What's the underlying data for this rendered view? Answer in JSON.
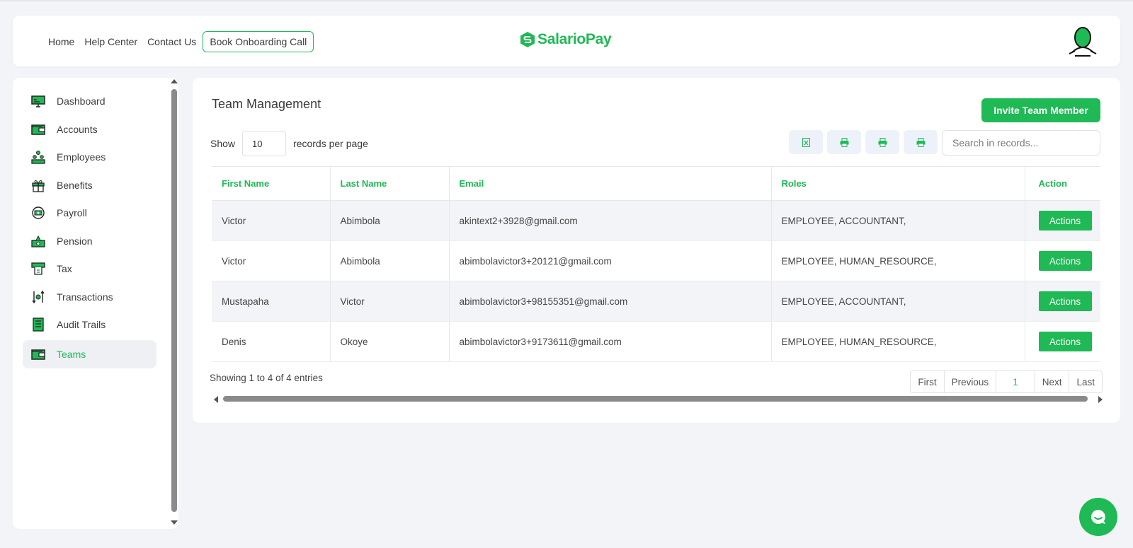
{
  "header": {
    "nav": [
      "Home",
      "Help Center",
      "Contact Us"
    ],
    "onboarding_button": "Book Onboarding Call",
    "brand": "SalarioPay"
  },
  "colors": {
    "accent": "#1fb955",
    "background": "#f3f4f7"
  },
  "sidebar": {
    "items": [
      {
        "label": "Dashboard",
        "icon": "monitor-icon"
      },
      {
        "label": "Accounts",
        "icon": "wallet-icon"
      },
      {
        "label": "Employees",
        "icon": "people-icon"
      },
      {
        "label": "Benefits",
        "icon": "gift-icon"
      },
      {
        "label": "Payroll",
        "icon": "cash-cycle-icon"
      },
      {
        "label": "Pension",
        "icon": "money-bag-icon"
      },
      {
        "label": "Tax",
        "icon": "receipt-icon"
      },
      {
        "label": "Transactions",
        "icon": "transfer-icon"
      },
      {
        "label": "Audit Trails",
        "icon": "clipboard-icon"
      },
      {
        "label": "Teams",
        "icon": "team-wallet-icon",
        "active": true
      }
    ]
  },
  "main": {
    "title": "Team Management",
    "invite_button": "Invite Team Member",
    "show_label": "Show",
    "per_page": "10",
    "records_label": "records per page",
    "search_placeholder": "Search in records...",
    "toolbar": [
      "excel-export-icon",
      "print-icon",
      "print-icon",
      "print-icon"
    ],
    "columns": [
      "First Name",
      "Last Name",
      "Email",
      "Roles",
      "Action"
    ],
    "rows": [
      {
        "first": "Victor",
        "last": "Abimbola",
        "email": "akintext2+3928@gmail.com",
        "roles": "EMPLOYEE, ACCOUNTANT,",
        "action": "Actions"
      },
      {
        "first": "Victor",
        "last": "Abimbola",
        "email": "abimbolavictor3+20121@gmail.com",
        "roles": "EMPLOYEE, HUMAN_RESOURCE,",
        "action": "Actions"
      },
      {
        "first": "Mustapaha",
        "last": "Victor",
        "email": "abimbolavictor3+98155351@gmail.com",
        "roles": "EMPLOYEE, ACCOUNTANT,",
        "action": "Actions"
      },
      {
        "first": "Denis",
        "last": "Okoye",
        "email": "abimbolavictor3+9173611@gmail.com",
        "roles": "EMPLOYEE, HUMAN_RESOURCE,",
        "action": "Actions"
      }
    ],
    "entries_text": "Showing 1 to 4 of 4 entries",
    "pager": {
      "first": "First",
      "previous": "Previous",
      "current": "1",
      "next": "Next",
      "last": "Last"
    }
  }
}
